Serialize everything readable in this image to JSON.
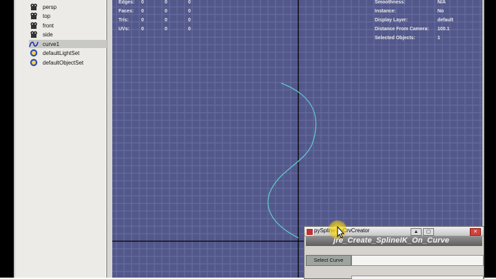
{
  "outliner": {
    "items": [
      {
        "label": "persp",
        "icon": "camera-icon"
      },
      {
        "label": "top",
        "icon": "camera-icon"
      },
      {
        "label": "front",
        "icon": "camera-icon"
      },
      {
        "label": "side",
        "icon": "camera-icon"
      },
      {
        "label": "curve1",
        "icon": "curve-icon",
        "selected": true
      },
      {
        "label": "defaultLightSet",
        "icon": "set-icon"
      },
      {
        "label": "defaultObjectSet",
        "icon": "set-icon"
      }
    ]
  },
  "hud": {
    "left": [
      {
        "label": "Edges:",
        "values": [
          "0",
          "0",
          "0"
        ]
      },
      {
        "label": "Faces:",
        "values": [
          "0",
          "0",
          "0"
        ]
      },
      {
        "label": "Tris:",
        "values": [
          "0",
          "0",
          "0"
        ]
      },
      {
        "label": "UVs:",
        "values": [
          "0",
          "0",
          "0"
        ]
      }
    ],
    "right": [
      {
        "label": "Smoothness:",
        "value": "N/A"
      },
      {
        "label": "Instance:",
        "value": "No"
      },
      {
        "label": "Display Layer:",
        "value": "default"
      },
      {
        "label": "Distance From Camera:",
        "value": "100.1"
      },
      {
        "label": "Selected Objects:",
        "value": "1"
      }
    ]
  },
  "tool_window": {
    "title": "pySplineOnCrvCreator",
    "banner": "jre_Create_SplineIK_On_Curve",
    "select_button": "Select Curve",
    "select_value": ""
  },
  "colors": {
    "viewport_bg": "#53588a",
    "grid": "#6a70a4",
    "curve": "#5fc9c9",
    "axis": "#000000"
  }
}
